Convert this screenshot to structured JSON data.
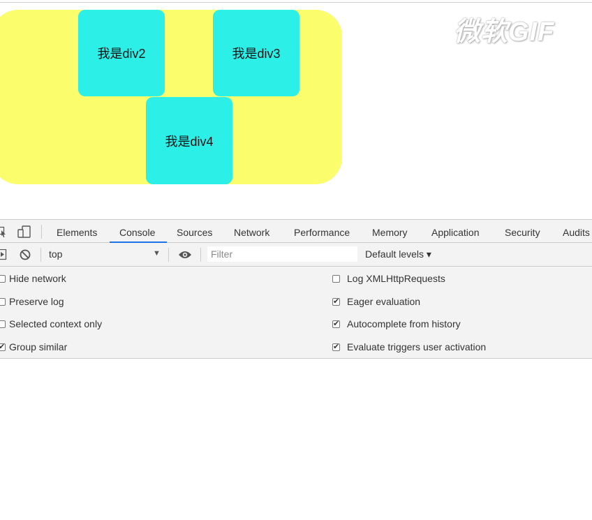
{
  "page": {
    "boxes": [
      {
        "label": "我是div2"
      },
      {
        "label": "我是div3"
      },
      {
        "label": "我是div4"
      }
    ],
    "watermark": "微软GIF"
  },
  "devtools": {
    "tabs": [
      "Elements",
      "Console",
      "Sources",
      "Network",
      "Performance",
      "Memory",
      "Application",
      "Security",
      "Audits"
    ],
    "active_tab": "Console",
    "toolbar": {
      "context": "top",
      "filter_placeholder": "Filter",
      "levels_label": "Default levels ▾"
    },
    "settings_left": [
      {
        "label": "Hide network",
        "checked": false
      },
      {
        "label": "Preserve log",
        "checked": false
      },
      {
        "label": "Selected context only",
        "checked": false
      },
      {
        "label": "Group similar",
        "checked": true
      }
    ],
    "settings_right": [
      {
        "label": "Log XMLHttpRequests",
        "checked": false
      },
      {
        "label": "Eager evaluation",
        "checked": true
      },
      {
        "label": "Autocomplete from history",
        "checked": true
      },
      {
        "label": "Evaluate triggers user activation",
        "checked": true
      }
    ]
  },
  "colors": {
    "yellow": "#fbfd6d",
    "cyan": "#2cf0e8",
    "accent": "#1a73e8"
  }
}
